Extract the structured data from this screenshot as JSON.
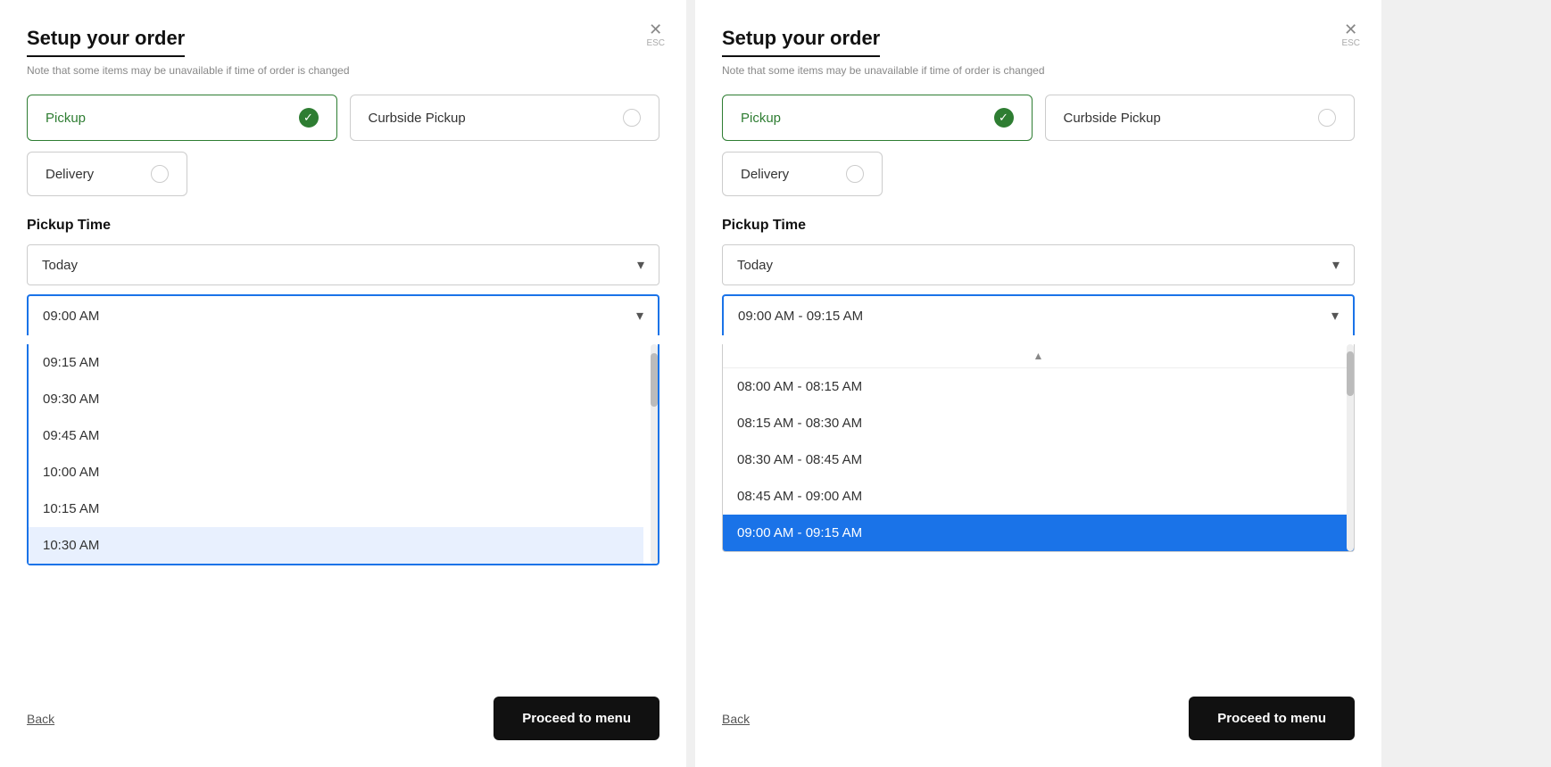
{
  "panels": [
    {
      "id": "left",
      "title": "Setup your order",
      "subtitle": "Note that some items may be unavailable if time of order is changed",
      "close_label": "ESC",
      "order_types": [
        {
          "label": "Pickup",
          "selected": true
        },
        {
          "label": "Curbside Pickup",
          "selected": false
        },
        {
          "label": "Delivery",
          "selected": false
        }
      ],
      "pickup_time_label": "Pickup Time",
      "day_dropdown": {
        "value": "Today",
        "chevron": "▾"
      },
      "time_dropdown": {
        "value": "09:00 AM",
        "chevron": "▾",
        "focused": true
      },
      "time_options": [
        {
          "label": "09:15 AM",
          "selected": false,
          "highlighted": false
        },
        {
          "label": "09:30 AM",
          "selected": false,
          "highlighted": false
        },
        {
          "label": "09:45 AM",
          "selected": false,
          "highlighted": false
        },
        {
          "label": "10:00 AM",
          "selected": false,
          "highlighted": false
        },
        {
          "label": "10:15 AM",
          "selected": false,
          "highlighted": false
        },
        {
          "label": "10:30 AM",
          "selected": false,
          "highlighted": true
        }
      ],
      "back_label": "Back",
      "proceed_label": "Proceed to menu"
    },
    {
      "id": "right",
      "title": "Setup your order",
      "subtitle": "Note that some items may be unavailable if time of order is changed",
      "close_label": "ESC",
      "order_types": [
        {
          "label": "Pickup",
          "selected": true
        },
        {
          "label": "Curbside Pickup",
          "selected": false
        },
        {
          "label": "Delivery",
          "selected": false
        }
      ],
      "pickup_time_label": "Pickup Time",
      "day_dropdown": {
        "value": "Today",
        "chevron": "▾"
      },
      "time_dropdown": {
        "value": "09:00 AM - 09:15 AM",
        "chevron": "▾",
        "focused": true
      },
      "scroll_up_icon": "▲",
      "time_options": [
        {
          "label": "08:00 AM - 08:15 AM",
          "selected": false,
          "highlighted": false
        },
        {
          "label": "08:15 AM - 08:30 AM",
          "selected": false,
          "highlighted": false
        },
        {
          "label": "08:30 AM - 08:45 AM",
          "selected": false,
          "highlighted": false
        },
        {
          "label": "08:45 AM - 09:00 AM",
          "selected": false,
          "highlighted": false
        },
        {
          "label": "09:00 AM - 09:15 AM",
          "selected": true,
          "highlighted": false
        }
      ],
      "back_label": "Back",
      "proceed_label": "Proceed to menu"
    }
  ],
  "colors": {
    "selected_green": "#2e7d32",
    "accent_blue": "#1a73e8",
    "highlight_light": "#e8f0fe",
    "selected_item_bg": "#1a73e8",
    "dark": "#111111"
  }
}
